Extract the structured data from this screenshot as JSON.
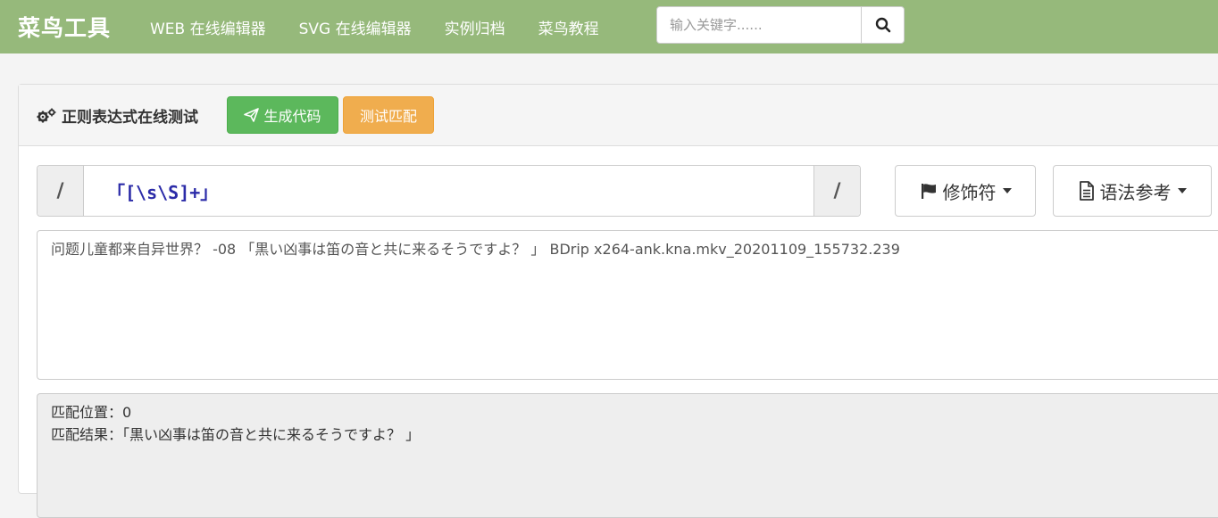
{
  "nav": {
    "brand": "菜鸟工具",
    "links": [
      "WEB 在线编辑器",
      "SVG 在线编辑器",
      "实例归档",
      "菜鸟教程"
    ],
    "search_placeholder": "输入关键字......"
  },
  "panel": {
    "title": "正则表达式在线测试",
    "generate_label": "生成代码",
    "test_label": "测试匹配"
  },
  "regex": {
    "left_delim": "/",
    "pattern": "「[\\s\\S]+」",
    "right_delim": "/",
    "modifier_label": "修饰符",
    "reference_label": "语法参考"
  },
  "input_text": "问题儿童都来自异世界？ -08 「黒い凶事は笛の音と共に来るそうですよ？ 」 BDrip x264-ank.kna.mkv_20201109_155732.239",
  "result": {
    "position_label": "匹配位置：",
    "position_value": "0",
    "match_label": "匹配结果：",
    "match_value": "「黒い凶事は笛の音と共に来るそうですよ？ 」"
  },
  "colors": {
    "navbar": "#96b97b",
    "success": "#5cb85c",
    "warning": "#f0ad4e",
    "regex_text": "#2b2ba8"
  },
  "icons": {
    "search": "search-icon",
    "gears": "gears-icon",
    "send": "paper-plane-icon",
    "flag": "flag-icon",
    "doc": "file-text-icon"
  }
}
